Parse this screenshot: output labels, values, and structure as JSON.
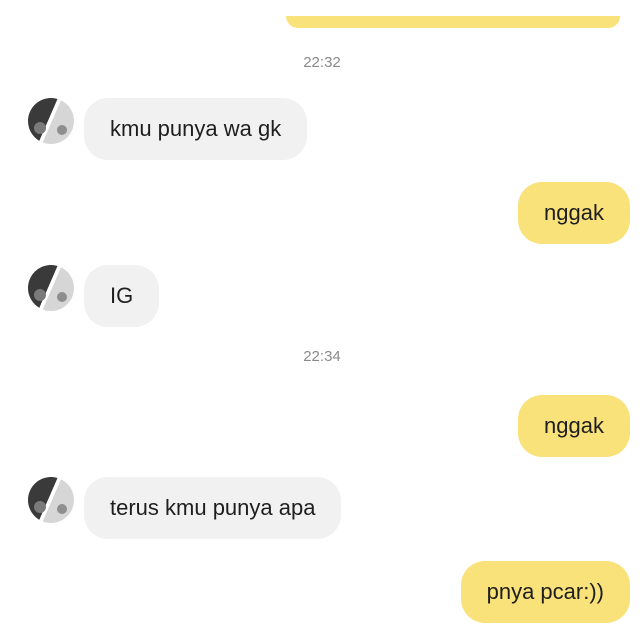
{
  "chat": {
    "colors": {
      "incoming_bubble": "#f1f1f1",
      "outgoing_bubble": "#f9e27a",
      "timestamp_text": "#8a8a8a"
    },
    "timestamps": [
      "22:32",
      "22:34"
    ],
    "messages": [
      {
        "direction": "incoming",
        "text": "kmu punya wa gk"
      },
      {
        "direction": "outgoing",
        "text": "nggak"
      },
      {
        "direction": "incoming",
        "text": "IG"
      },
      {
        "direction": "outgoing",
        "text": "nggak"
      },
      {
        "direction": "incoming",
        "text": "terus kmu punya apa"
      },
      {
        "direction": "outgoing",
        "text": "pnya pcar:))"
      }
    ],
    "avatar_icon": "profile-avatar-icon"
  }
}
